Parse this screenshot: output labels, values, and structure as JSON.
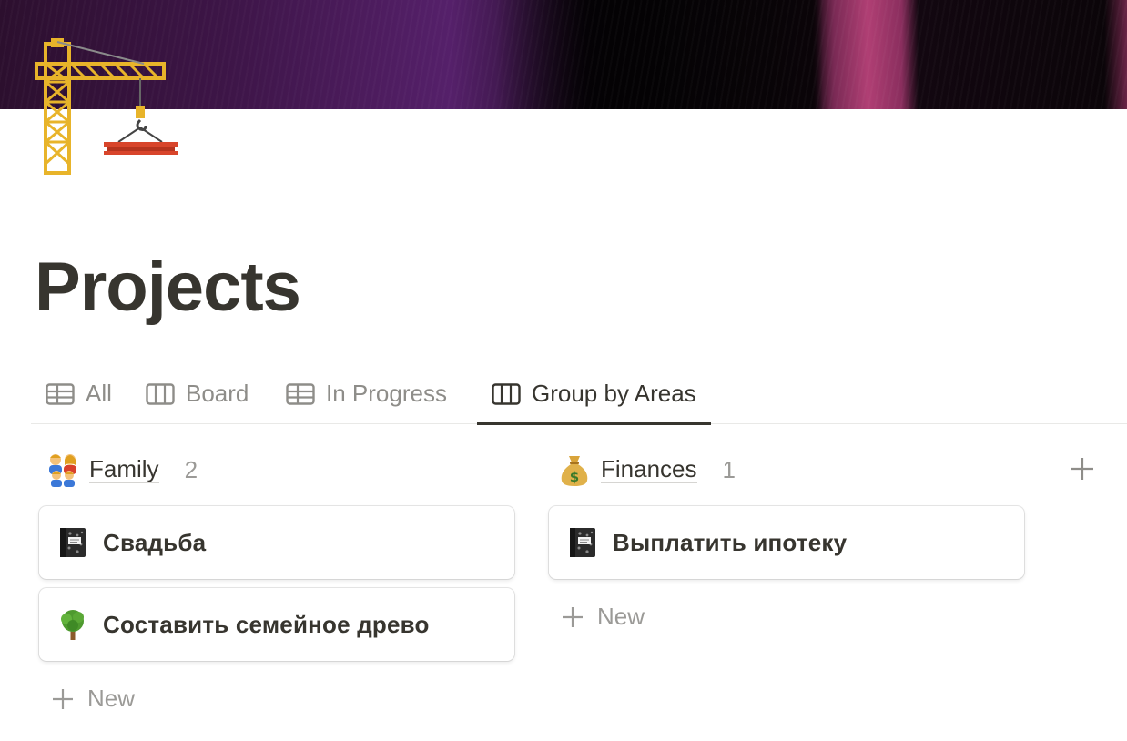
{
  "page": {
    "title": "Projects",
    "icon": "construction-crane-icon"
  },
  "tabs": [
    {
      "label": "All",
      "icon": "table-icon",
      "active": false
    },
    {
      "label": "Board",
      "icon": "board-icon",
      "active": false
    },
    {
      "label": "In Progress",
      "icon": "table-icon",
      "active": false
    },
    {
      "label": "Group by Areas",
      "icon": "board-icon",
      "active": true
    }
  ],
  "groups": [
    {
      "name": "Family",
      "emoji": "family-icon",
      "count": "2",
      "cards": [
        {
          "title": "Свадьба",
          "icon": "notebook-icon"
        },
        {
          "title": "Составить семейное древо",
          "icon": "tree-icon"
        }
      ],
      "new_label": "New"
    },
    {
      "name": "Finances",
      "emoji": "money-bag-icon",
      "count": "1",
      "cards": [
        {
          "title": "Выплатить ипотеку",
          "icon": "notebook-icon"
        }
      ],
      "new_label": "New"
    }
  ],
  "colors": {
    "text": "#37352f",
    "muted": "#9b9a97",
    "divider": "#e9e9e7"
  }
}
